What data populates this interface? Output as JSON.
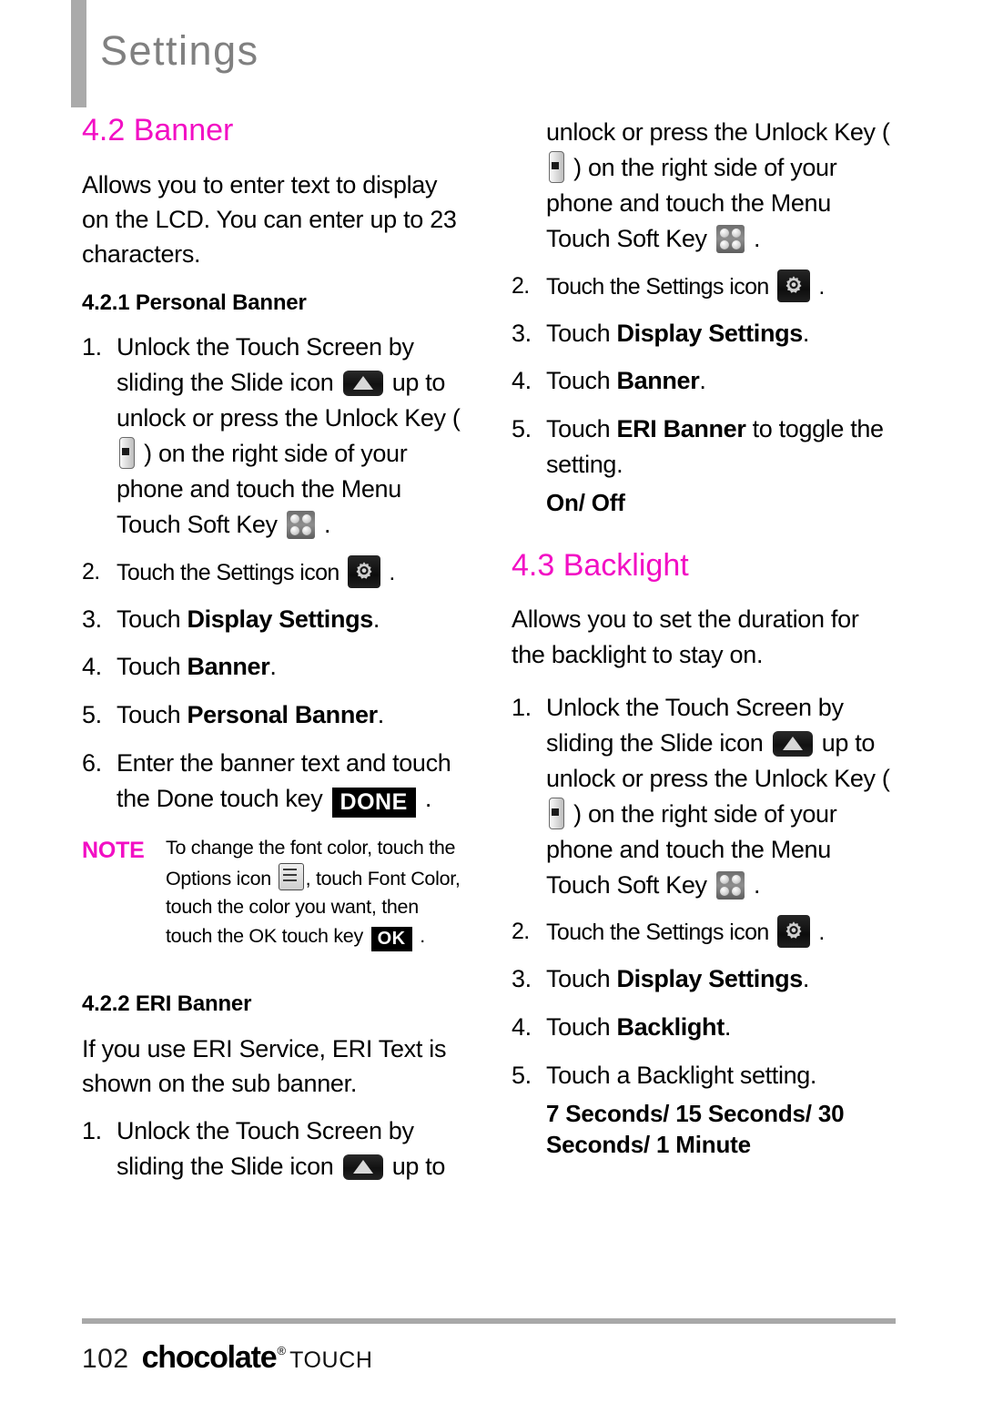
{
  "header": {
    "title": "Settings"
  },
  "colors": {
    "accent_magenta": "#F20FC4",
    "header_gray": "#808080",
    "rule_gray": "#A8A8A8"
  },
  "left_column": {
    "section": {
      "number_title": "4.2 Banner",
      "intro": "Allows you to enter text to display on the LCD. You can enter up to 23 characters."
    },
    "subsection_1": {
      "title": "4.2.1 Personal Banner",
      "steps": [
        {
          "num": "1.",
          "parts": [
            "Unlock the Touch Screen by sliding the Slide icon ",
            "SLIDE_ICON",
            " up to unlock or press the Unlock Key ( ",
            "KEY_ICON",
            " ) on the right side of your phone and touch the Menu Touch Soft Key ",
            "MENU_ICON",
            " ."
          ]
        },
        {
          "num": "2.",
          "text_before": "Touch the Settings icon ",
          "icon": "GEAR_ICON",
          "text_after": " ."
        },
        {
          "num": "3.",
          "text_before": "Touch ",
          "bold": "Display Settings",
          "text_after": "."
        },
        {
          "num": "4.",
          "text_before": "Touch ",
          "bold": "Banner",
          "text_after": "."
        },
        {
          "num": "5.",
          "text_before": "Touch ",
          "bold": "Personal Banner",
          "text_after": "."
        },
        {
          "num": "6.",
          "text_before": "Enter the banner text and touch the Done touch key ",
          "key": "DONE",
          "text_after": " ."
        }
      ]
    },
    "note": {
      "label": "NOTE",
      "part1": "To change the font color, touch the Options icon ",
      "options_icon": "OPTIONS_ICON",
      "part2": ", touch Font Color, touch the color you want, then touch the OK touch key ",
      "ok_key": "OK",
      "part3": " ."
    },
    "subsection_2": {
      "title": "4.2.2 ERI Banner",
      "intro": "If you use ERI Service, ERI Text is shown on the sub banner.",
      "step": {
        "num": "1.",
        "text": "Unlock the Touch Screen by sliding the Slide icon ",
        "icon": "SLIDE_ICON",
        "text_after": " up to"
      }
    }
  },
  "right_column": {
    "continuation": {
      "line1": "unlock or press the Unlock Key ( ",
      "key_icon": "KEY_ICON",
      "line2": " ) on the right side of your phone and touch the Menu Touch Soft Key ",
      "menu_icon": "MENU_ICON",
      "line3": " ."
    },
    "eri_steps": [
      {
        "num": "2.",
        "text_before": "Touch the Settings icon ",
        "icon": "GEAR_ICON",
        "text_after": " ."
      },
      {
        "num": "3.",
        "text_before": "Touch ",
        "bold": "Display Settings",
        "text_after": "."
      },
      {
        "num": "4.",
        "text_before": "Touch ",
        "bold": "Banner",
        "text_after": "."
      },
      {
        "num": "5.",
        "text_before": "Touch ",
        "bold": "ERI Banner",
        "text_after": " to toggle the setting.",
        "options": "On/ Off"
      }
    ],
    "backlight_section": {
      "number_title": "4.3 Backlight",
      "intro": "Allows you to set the duration for the backlight to stay on.",
      "steps": [
        {
          "num": "1.",
          "parts": [
            "Unlock the Touch Screen by sliding the Slide icon ",
            "SLIDE_ICON",
            " up to unlock or press the Unlock Key ( ",
            "KEY_ICON",
            " ) on the right side of your phone and touch the Menu Touch Soft Key ",
            "MENU_ICON",
            " ."
          ]
        },
        {
          "num": "2.",
          "text_before": "Touch the Settings icon ",
          "icon": "GEAR_ICON",
          "text_after": " ."
        },
        {
          "num": "3.",
          "text_before": "Touch ",
          "bold": "Display Settings",
          "text_after": "."
        },
        {
          "num": "4.",
          "text_before": "Touch ",
          "bold": "Backlight",
          "text_after": "."
        },
        {
          "num": "5.",
          "text_before": "Touch a Backlight setting.",
          "options": "7 Seconds/ 15 Seconds/ 30 Seconds/ 1 Minute"
        }
      ]
    }
  },
  "footer": {
    "page_number": "102",
    "brand": "chocolate",
    "brand_mark": "®",
    "brand_sub": "TOUCH"
  },
  "icon_names": {
    "slide": "slide-up-icon",
    "key": "unlock-key-icon",
    "menu": "menu-soft-key-icon",
    "gear": "settings-gear-icon",
    "options": "options-list-icon"
  }
}
